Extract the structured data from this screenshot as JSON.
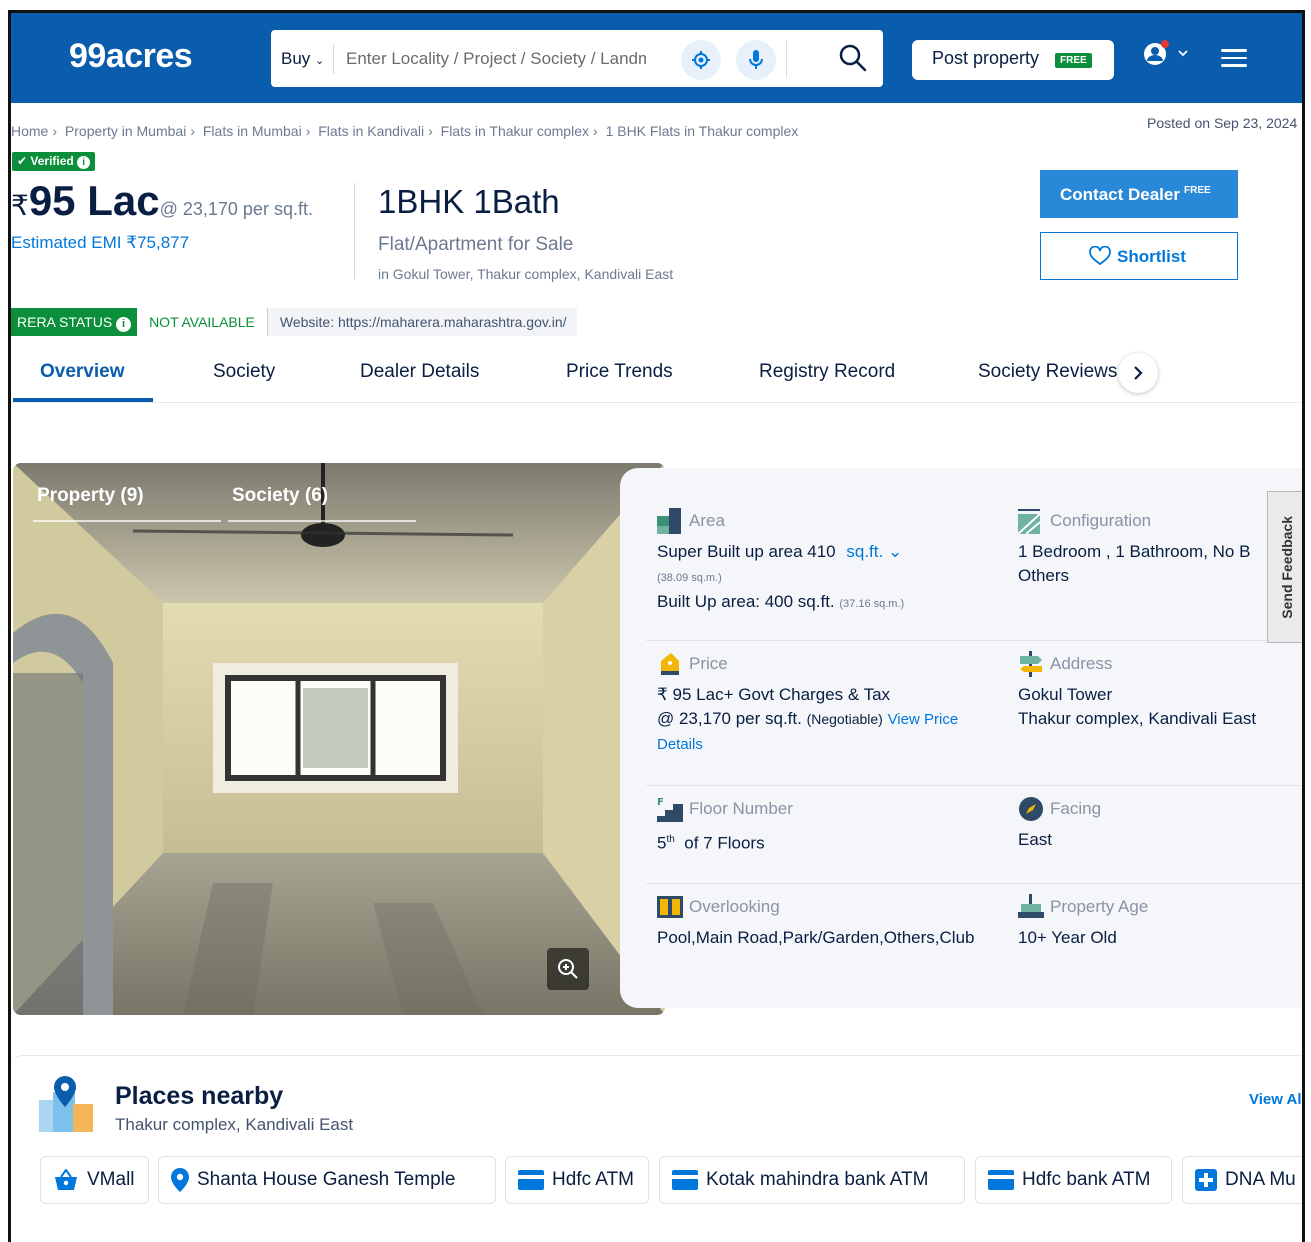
{
  "header": {
    "logo": "99acres",
    "buy_label": "Buy",
    "search_placeholder": "Enter Locality / Project / Society / Landmark",
    "post_property": "Post property",
    "free_badge": "FREE"
  },
  "breadcrumb": [
    "Home",
    "Property in Mumbai",
    "Flats in Mumbai",
    "Flats in Kandivali",
    "Flats in Thakur complex",
    "1 BHK Flats in Thakur complex"
  ],
  "posted_on": "Posted on Sep 23, 2024",
  "listing": {
    "verified": "Verified",
    "currency": "₹",
    "price": "95 Lac",
    "price_per_sqft": "@ 23,170 per sq.ft.",
    "emi": "Estimated EMI ₹75,877",
    "title": "1BHK 1Bath",
    "subtitle": "Flat/Apartment for Sale",
    "location": "in Gokul Tower, Thakur complex, Kandivali East",
    "contact_dealer": "Contact Dealer",
    "contact_free": "FREE",
    "shortlist": "Shortlist"
  },
  "rera": {
    "label": "RERA STATUS",
    "status": "NOT AVAILABLE",
    "website": "Website: https://maharera.maharashtra.gov.in/"
  },
  "tabs": [
    "Overview",
    "Society",
    "Dealer Details",
    "Price Trends",
    "Registry Record",
    "Society Reviews"
  ],
  "gallery": {
    "property_tab": "Property (9)",
    "society_tab": "Society (6)"
  },
  "details": {
    "area": {
      "label": "Area",
      "line1": "Super Built up area 410",
      "unit": "sq.ft.",
      "sqm1": "(38.09 sq.m.)",
      "line2": "Built Up area: 400 sq.ft.",
      "sqm2": "(37.16 sq.m.)"
    },
    "configuration": {
      "label": "Configuration",
      "line1": "1 Bedroom , 1 Bathroom, No B",
      "line2": "Others"
    },
    "price": {
      "label": "Price",
      "line1": "₹ 95 Lac+ Govt Charges & Tax",
      "line2": "@ 23,170 per sq.ft.",
      "negotiable": "(Negotiable)",
      "link": "View Price",
      "link2": "Details"
    },
    "address": {
      "label": "Address",
      "line1": "Gokul Tower",
      "line2": "Thakur complex, Kandivali East"
    },
    "floor": {
      "label": "Floor Number",
      "value_num": "5",
      "value_sup": "th",
      "value_rest": "of 7 Floors"
    },
    "facing": {
      "label": "Facing",
      "value": "East"
    },
    "overlooking": {
      "label": "Overlooking",
      "value": "Pool,Main Road,Park/Garden,Others,Club"
    },
    "age": {
      "label": "Property Age",
      "value": "10+ Year Old"
    }
  },
  "feedback": "Send Feedback",
  "places": {
    "title": "Places nearby",
    "subtitle": "Thakur complex, Kandivali East",
    "view_all": "View All",
    "items": [
      "VMall",
      "Shanta House Ganesh Temple",
      "Hdfc ATM",
      "Kotak mahindra bank ATM",
      "Hdfc bank ATM",
      "DNA Mu"
    ]
  },
  "colors": {
    "brand_blue": "#0a5cad",
    "link_blue": "#0078db",
    "green": "#0b8f3a"
  }
}
